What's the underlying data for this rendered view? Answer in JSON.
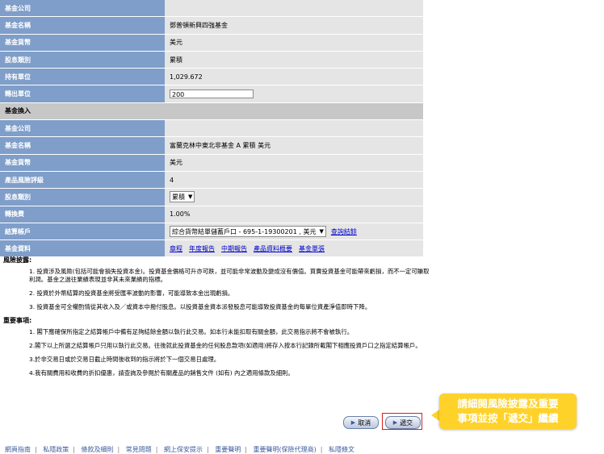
{
  "fund_out": {
    "company_label": "基金公司",
    "name_label": "基金名稱",
    "name_value": "鄧普頓新興四強基金",
    "currency_label": "基金貨幣",
    "currency_value": "美元",
    "dividend_label": "股息類別",
    "dividend_value": "累積",
    "units_label": "持有單位",
    "units_value": "1,029.672",
    "switch_units_label": "轉出單位",
    "switch_units_value": "200"
  },
  "fund_in": {
    "section_title": "基金換入",
    "company_label": "基金公司",
    "name_label": "基金名稱",
    "name_value": "富蘭克林中東北非基金 A 累積 美元",
    "currency_label": "基金貨幣",
    "currency_value": "美元",
    "risk_label": "產品風險評級",
    "risk_value": "4",
    "dividend_label": "股息類別",
    "dividend_value": "累積",
    "fee_label": "轉換費",
    "fee_value": "1.00%",
    "account_label": "結算帳戶",
    "account_value": "綜合貨幣結單儲蓄戶口 - 695-1-19300201 , 美元",
    "account_link": "查詢結餘",
    "docs_label": "基金資料",
    "docs_links": [
      "章程",
      "年度報告",
      "中期報告",
      "產品資料概要",
      "基金單張"
    ]
  },
  "risk_disclosure": {
    "title": "風險披露:",
    "items": [
      "1. 投資涉及風險(包括可能會損失投資本金)。投資基金價格可升亦可跌，並可能非常波動及變成沒有價值。買賣投資基金可能帶來虧損，而不一定可賺取利潤。基金之過往業績表現並非其未來業績的指標。",
      "2. 投資於外幣結算的投資基金將受匯率波動的影響，可能導致本金出現虧損。",
      "3. 投資基金可全權酌情從其收入及／或資本中撥付股息。以投資基金資本派發股息可能導致投資基金的每單位資產淨值即時下降。"
    ]
  },
  "important": {
    "title": "重要事項:",
    "items": [
      "1. 閣下應確保所指定之結算帳戶中備有足夠結餘金額以執行此交易。如本行未能扣取有關金額，此交易指示將不會被執行。",
      "2.閣下以上所選之結算帳戶只用以執行此交易。往後就此投資基金的任何股息款項(如適用)將存入按本行記錄所載閣下相應投資戶口之指定結算帳戶。",
      "3.於非交易日或於交易日截止時間後收到的指示將於下一個交易日處理。",
      "4.我有關費用和收費的折扣優惠，請查詢及參閱於有關產品的銷售文件 (如有) 內之適用條款及細則。"
    ]
  },
  "buttons": {
    "cancel": "取消",
    "submit": "遞交"
  },
  "callout": {
    "line1": "請細閱風險披露及重要",
    "line2": "事項並按「遞交」繼續"
  },
  "footer": [
    "網頁指南",
    "私隱政策",
    "條款及細則",
    "常見問題",
    "網上保安提示",
    "重要聲明",
    "重要聲明(保險代理商)",
    "私隱條文"
  ]
}
